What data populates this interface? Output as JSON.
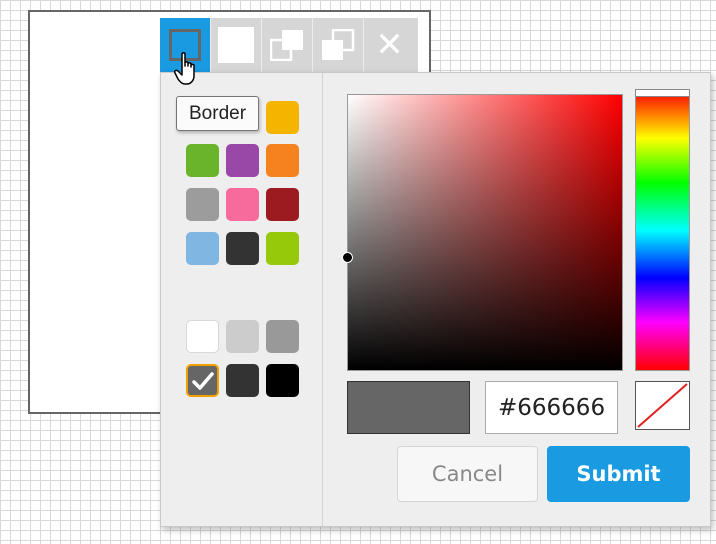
{
  "toolbar": {
    "buttons": [
      {
        "name": "border",
        "icon": "border-icon",
        "active": true
      },
      {
        "name": "fill",
        "icon": "fill-icon"
      },
      {
        "name": "bring-to-front",
        "icon": "bring-to-front-icon"
      },
      {
        "name": "send-to-back",
        "icon": "send-to-back-icon"
      },
      {
        "name": "close",
        "icon": "close-icon",
        "glyph": "✕"
      }
    ]
  },
  "tooltip": {
    "text": "Border"
  },
  "swatches": {
    "colors": [
      "#f5b400",
      "#6ab42c",
      "#9a48a8",
      "#f5821f",
      "#9c9c9c",
      "#f76b9c",
      "#9b1b21",
      "#7fb6e2",
      "#333333",
      "#95c90a",
      "#ffffff",
      "#cccccc",
      "#999999",
      "#666666",
      "#333333",
      "#000000"
    ],
    "selected": "#666666"
  },
  "picker": {
    "hue_color": "#ff0000",
    "current_color": "#666666"
  },
  "hex_input": {
    "value": "#666666"
  },
  "buttons": {
    "cancel": "Cancel",
    "submit": "Submit"
  },
  "colors": {
    "accent": "#1a9ae0",
    "selection": "#f0a000",
    "shape_border": "#666666"
  }
}
